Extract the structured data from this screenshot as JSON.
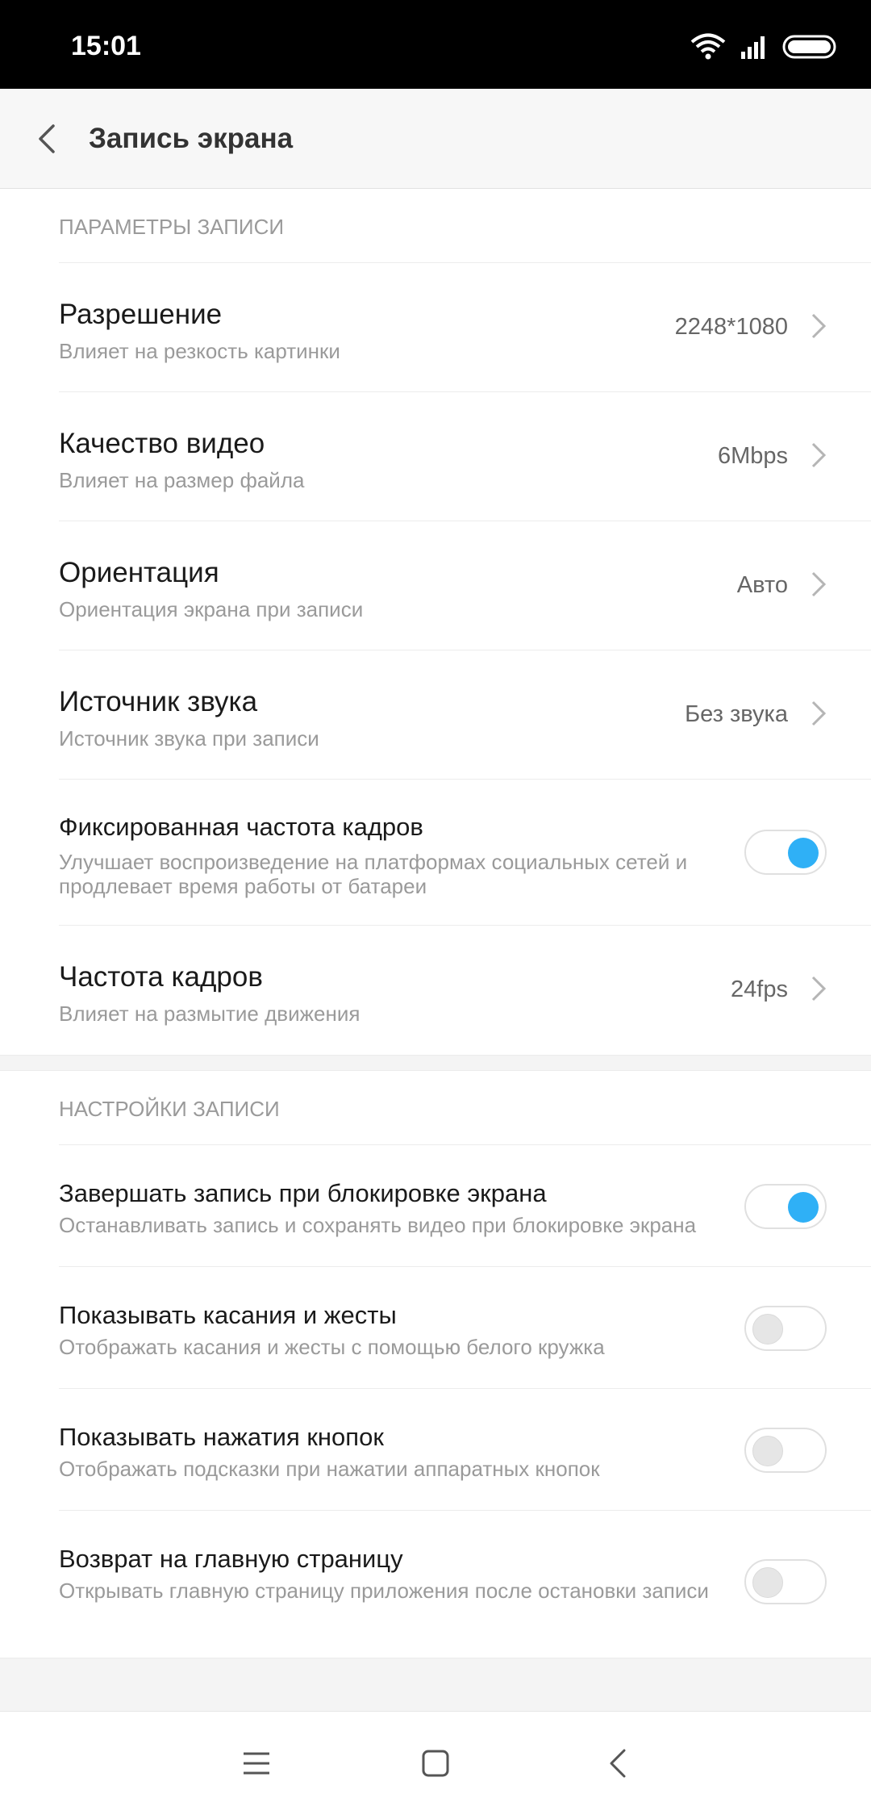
{
  "status_bar": {
    "time": "15:01"
  },
  "header": {
    "title": "Запись экрана"
  },
  "sections": {
    "recording_params": {
      "header": "ПАРАМЕТРЫ ЗАПИСИ",
      "items": {
        "resolution": {
          "title": "Разрешение",
          "subtitle": "Влияет на резкость картинки",
          "value": "2248*1080"
        },
        "quality": {
          "title": "Качество видео",
          "subtitle": "Влияет на размер файла",
          "value": "6Mbps"
        },
        "orientation": {
          "title": "Ориентация",
          "subtitle": "Ориентация экрана при записи",
          "value": "Авто"
        },
        "sound": {
          "title": "Источник звука",
          "subtitle": "Источник звука при записи",
          "value": "Без звука"
        },
        "fixed_fps": {
          "title": "Фиксированная частота кадров",
          "subtitle": "Улучшает воспроизведение на платформах социальных сетей и продлевает время работы от батареи",
          "enabled": true
        },
        "fps": {
          "title": "Частота кадров",
          "subtitle": "Влияет на размытие движения",
          "value": "24fps"
        }
      }
    },
    "recording_settings": {
      "header": "НАСТРОЙКИ ЗАПИСИ",
      "items": {
        "stop_on_lock": {
          "title": "Завершать запись при блокировке экрана",
          "subtitle": "Останавливать запись и сохранять видео при блокировке экрана",
          "enabled": true
        },
        "show_touches": {
          "title": "Показывать касания и жесты",
          "subtitle": "Отображать касания и жесты с помощью белого кружка",
          "enabled": false
        },
        "show_buttons": {
          "title": "Показывать нажатия кнопок",
          "subtitle": "Отображать подсказки при нажатии аппаратных кнопок",
          "enabled": false
        },
        "return_home": {
          "title": "Возврат на главную страницу",
          "subtitle": "Открывать главную страницу приложения после остановки записи",
          "enabled": false
        }
      }
    }
  },
  "colors": {
    "accent": "#2fb0f6",
    "toggle_off": "#e6e6e6",
    "status_bar": "#000000",
    "app_bar": "#f7f7f7"
  },
  "icons": {
    "back": "chevron-left-icon",
    "chevron": "chevron-right-icon",
    "menu": "menu-icon",
    "home": "home-icon",
    "nav_back": "back-icon"
  }
}
